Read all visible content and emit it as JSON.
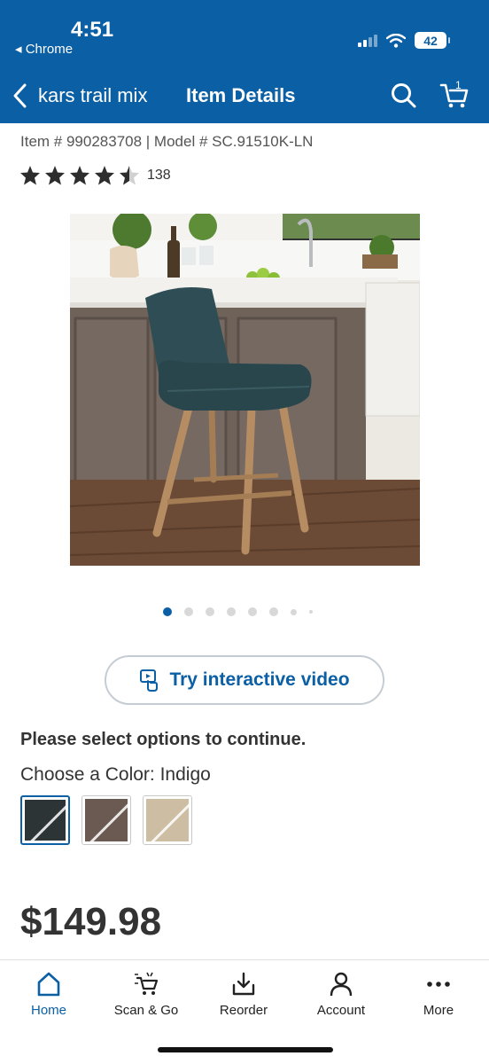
{
  "status_bar": {
    "time": "4:51",
    "back_app": "◂ Chrome",
    "battery": "42"
  },
  "nav": {
    "back_label": "kars trail mix",
    "title": "Item Details",
    "cart_count": "1"
  },
  "product": {
    "item_line": "Item # 990283708 | Model # SC.91510K-LN",
    "rating": 4.5,
    "review_count": "138",
    "image_count": 8,
    "current_image": 1
  },
  "video_button": {
    "label": "Try interactive video"
  },
  "options": {
    "prompt": "Please select options to continue.",
    "color_label": "Choose a Color: Indigo",
    "swatches": [
      {
        "name": "Indigo",
        "color": "#2c3436",
        "selected": true
      },
      {
        "name": "Brown",
        "color": "#6a5a52",
        "selected": false
      },
      {
        "name": "Beige",
        "color": "#cdbda3",
        "selected": false
      }
    ]
  },
  "price": "$149.98",
  "tabbar": {
    "home": "Home",
    "scan": "Scan & Go",
    "reorder": "Reorder",
    "account": "Account",
    "more": "More"
  },
  "colors": {
    "brand_blue": "#0b5fa5"
  }
}
